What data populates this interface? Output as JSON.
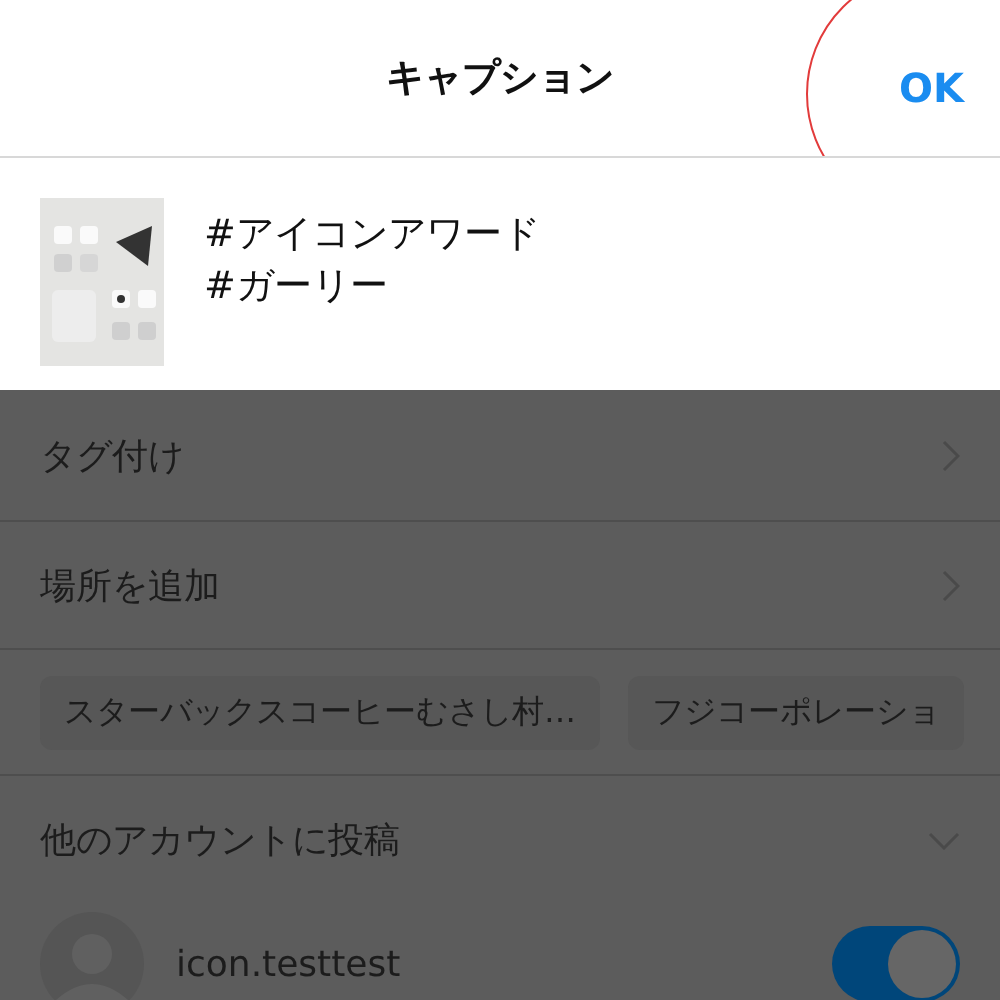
{
  "header": {
    "title": "キャプション",
    "done_button": "OK",
    "done_highlighted": true
  },
  "caption": {
    "lines": [
      "#アイコンアワード",
      "#ガーリー"
    ]
  },
  "dimmed": true,
  "rows": [
    {
      "kind": "link",
      "label": "タグ付け"
    },
    {
      "kind": "link",
      "label": "場所を追加"
    },
    {
      "kind": "chips",
      "chips": [
        "スターバックスコーヒーむさし村…",
        "フジコーポレーショ"
      ]
    },
    {
      "kind": "expander",
      "label": "他のアカウントに投稿",
      "expanded": false
    },
    {
      "kind": "account",
      "name": "icon.testtest",
      "on": true
    }
  ]
}
